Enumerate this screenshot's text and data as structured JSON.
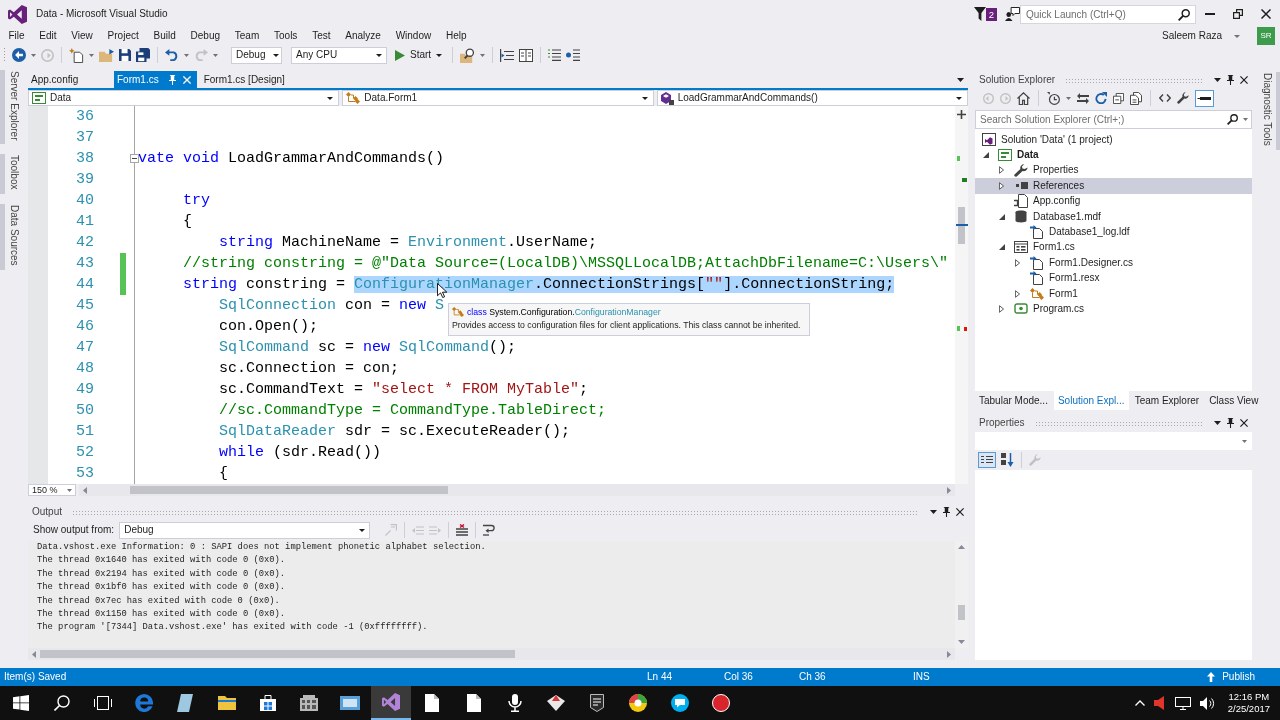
{
  "window": {
    "title": "Data - Microsoft Visual Studio"
  },
  "title_bar": {
    "notifications": "2",
    "quick_launch": {
      "placeholder": "Quick Launch (Ctrl+Q)"
    }
  },
  "menu": [
    "File",
    "Edit",
    "View",
    "Project",
    "Build",
    "Debug",
    "Team",
    "Tools",
    "Test",
    "Analyze",
    "Window",
    "Help"
  ],
  "account": {
    "name": "Saleem Raza",
    "initials": "SR"
  },
  "toolbar": {
    "configuration": "Debug",
    "platform": "Any CPU",
    "start": "Start"
  },
  "left_tool_tabs": [
    "Server Explorer",
    "Toolbox",
    "Data Sources"
  ],
  "document_tabs": [
    {
      "label": "App.config",
      "selected": false
    },
    {
      "label": "Form1.cs",
      "selected": true
    },
    {
      "label": "Form1.cs [Design]",
      "selected": false
    }
  ],
  "navigation_bar": [
    {
      "kind": "project",
      "label": "Data"
    },
    {
      "kind": "class",
      "label": "Data.Form1"
    },
    {
      "kind": "method",
      "label": "LoadGrammarAndCommands()"
    }
  ],
  "editor": {
    "lines": [
      {
        "number": "36",
        "changed": false
      },
      {
        "number": "37",
        "changed": false
      },
      {
        "number": "38",
        "changed": false,
        "expanded": true,
        "tokens": [
          {
            "kind": "keyword",
            "text": "vate "
          },
          {
            "kind": "keyword",
            "text": "void"
          },
          {
            "kind": "plain",
            "text": " LoadGrammarAndCommands()"
          }
        ]
      },
      {
        "number": "39",
        "changed": false
      },
      {
        "number": "40",
        "changed": false,
        "tokens": [
          {
            "kind": "keyword",
            "text": "     try"
          }
        ]
      },
      {
        "number": "41",
        "changed": false,
        "tokens": [
          {
            "kind": "plain",
            "text": "     {"
          }
        ]
      },
      {
        "number": "42",
        "changed": false,
        "tokens": [
          {
            "kind": "keyword",
            "text": "         string"
          },
          {
            "kind": "plain",
            "text": " MachineName = "
          },
          {
            "kind": "type",
            "text": "Environment"
          },
          {
            "kind": "plain",
            "text": ".UserName;"
          }
        ]
      },
      {
        "number": "43",
        "changed": true,
        "tokens": [
          {
            "kind": "comment",
            "text": "     //string constring = @\"Data Source=(LocalDB)\\MSSQLLocalDB;AttachDbFilename=C:\\Users\\\""
          }
        ]
      },
      {
        "number": "44",
        "changed": true,
        "tokens": [
          {
            "kind": "keyword",
            "text": "     string",
            "selected": false
          },
          {
            "kind": "plain",
            "text": " constring = ",
            "selected": false
          },
          {
            "kind": "type",
            "text": "ConfigurationManager",
            "selected": true
          },
          {
            "kind": "plain",
            "text": ".ConnectionStrings[",
            "selected": true
          },
          {
            "kind": "string",
            "text": "\"\"",
            "selected": true
          },
          {
            "kind": "plain",
            "text": "].ConnectionString;",
            "selected": true
          }
        ]
      },
      {
        "number": "45",
        "changed": false,
        "tokens": [
          {
            "kind": "type",
            "text": "         SqlConnection"
          },
          {
            "kind": "plain",
            "text": " con = "
          },
          {
            "kind": "keyword",
            "text": "new "
          },
          {
            "kind": "type",
            "text": "S"
          }
        ]
      },
      {
        "number": "46",
        "changed": false,
        "tokens": [
          {
            "kind": "plain",
            "text": "         con.Open();"
          }
        ]
      },
      {
        "number": "47",
        "changed": false,
        "tokens": [
          {
            "kind": "type",
            "text": "         SqlCommand"
          },
          {
            "kind": "plain",
            "text": " sc = "
          },
          {
            "kind": "keyword",
            "text": "new "
          },
          {
            "kind": "type",
            "text": "SqlCommand"
          },
          {
            "kind": "plain",
            "text": "();"
          }
        ]
      },
      {
        "number": "48",
        "changed": false,
        "tokens": [
          {
            "kind": "plain",
            "text": "         sc.Connection = con;"
          }
        ]
      },
      {
        "number": "49",
        "changed": false,
        "tokens": [
          {
            "kind": "plain",
            "text": "         sc.CommandText = "
          },
          {
            "kind": "string",
            "text": "\"select * FROM MyTable\""
          },
          {
            "kind": "plain",
            "text": ";"
          }
        ]
      },
      {
        "number": "50",
        "changed": false,
        "tokens": [
          {
            "kind": "comment",
            "text": "         //sc.CommandType = CommandType.TableDirect;"
          }
        ]
      },
      {
        "number": "51",
        "changed": false,
        "tokens": [
          {
            "kind": "type",
            "text": "         SqlDataReader"
          },
          {
            "kind": "plain",
            "text": " sdr = sc.ExecuteReader();"
          }
        ]
      },
      {
        "number": "52",
        "changed": false,
        "tokens": [
          {
            "kind": "keyword",
            "text": "         while"
          },
          {
            "kind": "plain",
            "text": " (sdr.Read())"
          }
        ]
      },
      {
        "number": "53",
        "changed": false,
        "tokens": [
          {
            "kind": "plain",
            "text": "         {"
          }
        ]
      }
    ],
    "tooltip": {
      "signature": [
        {
          "kind": "keyword",
          "text": "class "
        },
        {
          "kind": "plain",
          "text": "System.Configuration."
        },
        {
          "kind": "type",
          "text": "ConfigurationManager"
        }
      ],
      "description": "Provides access to configuration files for client applications. This class cannot be inherited."
    },
    "zoom": "150 %"
  },
  "output": {
    "title": "Output",
    "source_label": "Show output from:",
    "source": "Debug",
    "lines": [
      "Data.vshost.exe Information: 0 : SAPI does not implement phonetic alphabet selection.",
      "The thread 0x1640 has exited with code 0 (0x0).",
      "The thread 0x2194 has exited with code 0 (0x0).",
      "The thread 0x1bf0 has exited with code 0 (0x0).",
      "The thread 0x7ec has exited with code 0 (0x0).",
      "The thread 0x1150 has exited with code 0 (0x0).",
      "The program '[7344] Data.vshost.exe' has exited with code -1 (0xffffffff)."
    ]
  },
  "solution_explorer": {
    "title": "Solution Explorer",
    "search": {
      "placeholder": "Search Solution Explorer (Ctrl+;)"
    },
    "tree": [
      {
        "label": "Solution 'Data' (1 project)",
        "kind": "solution",
        "selected": false,
        "children": [
          {
            "label": "Data",
            "kind": "project",
            "expanded": true,
            "selected": false,
            "children": [
              {
                "label": "Properties",
                "kind": "properties",
                "expanded": false,
                "selected": false
              },
              {
                "label": "References",
                "kind": "references",
                "expanded": false,
                "selected": true
              },
              {
                "label": "App.config",
                "kind": "config",
                "selected": false
              },
              {
                "label": "Database1.mdf",
                "kind": "database",
                "expanded": true,
                "selected": false,
                "children": [
                  {
                    "label": "Database1_log.ldf",
                    "kind": "file",
                    "selected": false
                  }
                ]
              },
              {
                "label": "Form1.cs",
                "kind": "form",
                "expanded": true,
                "selected": false,
                "children": [
                  {
                    "label": "Form1.Designer.cs",
                    "kind": "file",
                    "expanded": false,
                    "selected": false
                  },
                  {
                    "label": "Form1.resx",
                    "kind": "file",
                    "selected": false
                  },
                  {
                    "label": "Form1",
                    "kind": "class",
                    "expanded": false,
                    "selected": false
                  }
                ]
              },
              {
                "label": "Program.cs",
                "kind": "code",
                "expanded": false,
                "selected": false
              }
            ]
          }
        ]
      }
    ]
  },
  "tool_tabs": [
    {
      "label": "Tabular Mode...",
      "selected": false
    },
    {
      "label": "Solution Expl...",
      "selected": true
    },
    {
      "label": "Team Explorer",
      "selected": false
    },
    {
      "label": "Class View",
      "selected": false
    }
  ],
  "properties": {
    "title": "Properties"
  },
  "right_tool_tabs": [
    "Diagnostic Tools"
  ],
  "status_bar": {
    "message": "Item(s) Saved",
    "line": "Ln 44",
    "column": "Col 36",
    "character": "Ch 36",
    "mode": "INS",
    "publish": "Publish"
  },
  "taskbar": {
    "apps": [
      {
        "kind": "start",
        "selected": false
      },
      {
        "kind": "search",
        "selected": false
      },
      {
        "kind": "task_view",
        "selected": false
      },
      {
        "kind": "browser",
        "selected": false
      },
      {
        "kind": "tile",
        "selected": false
      },
      {
        "kind": "folder",
        "selected": false
      },
      {
        "kind": "store",
        "selected": false
      },
      {
        "kind": "building",
        "selected": false
      },
      {
        "kind": "window",
        "selected": false
      },
      {
        "kind": "ide",
        "selected": true
      },
      {
        "kind": "document",
        "selected": false
      },
      {
        "kind": "document",
        "selected": false
      },
      {
        "kind": "microphone",
        "selected": false
      },
      {
        "kind": "kite",
        "selected": false
      },
      {
        "kind": "shield",
        "selected": false
      },
      {
        "kind": "circle_logo",
        "selected": false
      },
      {
        "kind": "chat",
        "selected": false
      },
      {
        "kind": "record",
        "selected": false
      }
    ],
    "time": "12:16 PM",
    "date": "2/25/2017"
  }
}
